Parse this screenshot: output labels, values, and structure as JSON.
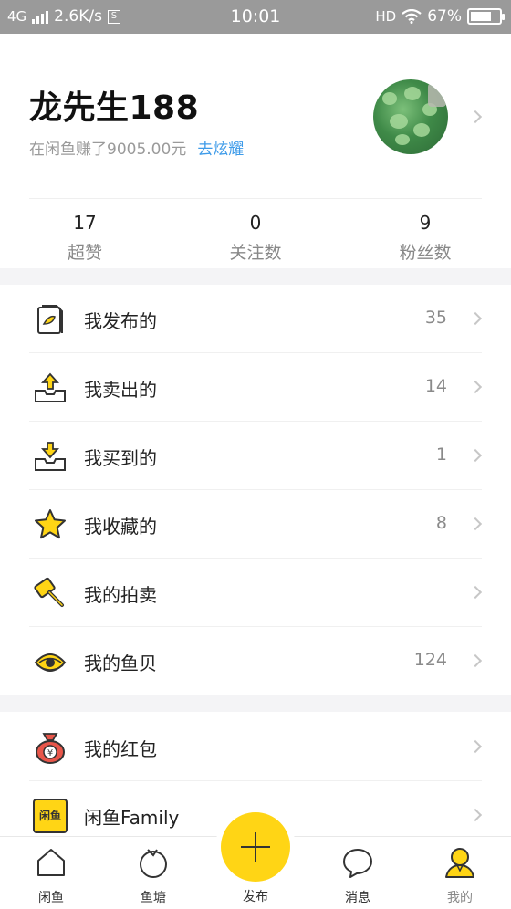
{
  "status_bar": {
    "network": "4G",
    "speed": "2.6K/s",
    "s_icon": "S",
    "time": "10:01",
    "hd": "HD",
    "battery": "67%"
  },
  "profile": {
    "name": "龙先生188",
    "earned": "在闲鱼赚了9005.00元",
    "show_off": "去炫耀"
  },
  "stats": [
    {
      "num": "17",
      "label": "超赞"
    },
    {
      "num": "0",
      "label": "关注数"
    },
    {
      "num": "9",
      "label": "粉丝数"
    }
  ],
  "menu": [
    {
      "label": "我发布的",
      "count": "35",
      "icon": "published-icon"
    },
    {
      "label": "我卖出的",
      "count": "14",
      "icon": "sold-icon"
    },
    {
      "label": "我买到的",
      "count": "1",
      "icon": "bought-icon"
    },
    {
      "label": "我收藏的",
      "count": "8",
      "icon": "star-icon"
    },
    {
      "label": "我的拍卖",
      "count": "",
      "icon": "auction-hammer-icon"
    },
    {
      "label": "我的鱼贝",
      "count": "124",
      "icon": "shell-icon"
    }
  ],
  "menu2": [
    {
      "label": "我的红包",
      "icon": "red-packet-icon"
    },
    {
      "label": "闲鱼Family",
      "icon": "family-icon",
      "badge": "闲鱼"
    }
  ],
  "tabbar": {
    "home": "闲鱼",
    "pond": "鱼塘",
    "publish": "发布",
    "messages": "消息",
    "mine": "我的"
  },
  "colors": {
    "accent_yellow": "#ffd515",
    "link_blue": "#3e9be9",
    "status_bar": "#9a9a9a"
  }
}
